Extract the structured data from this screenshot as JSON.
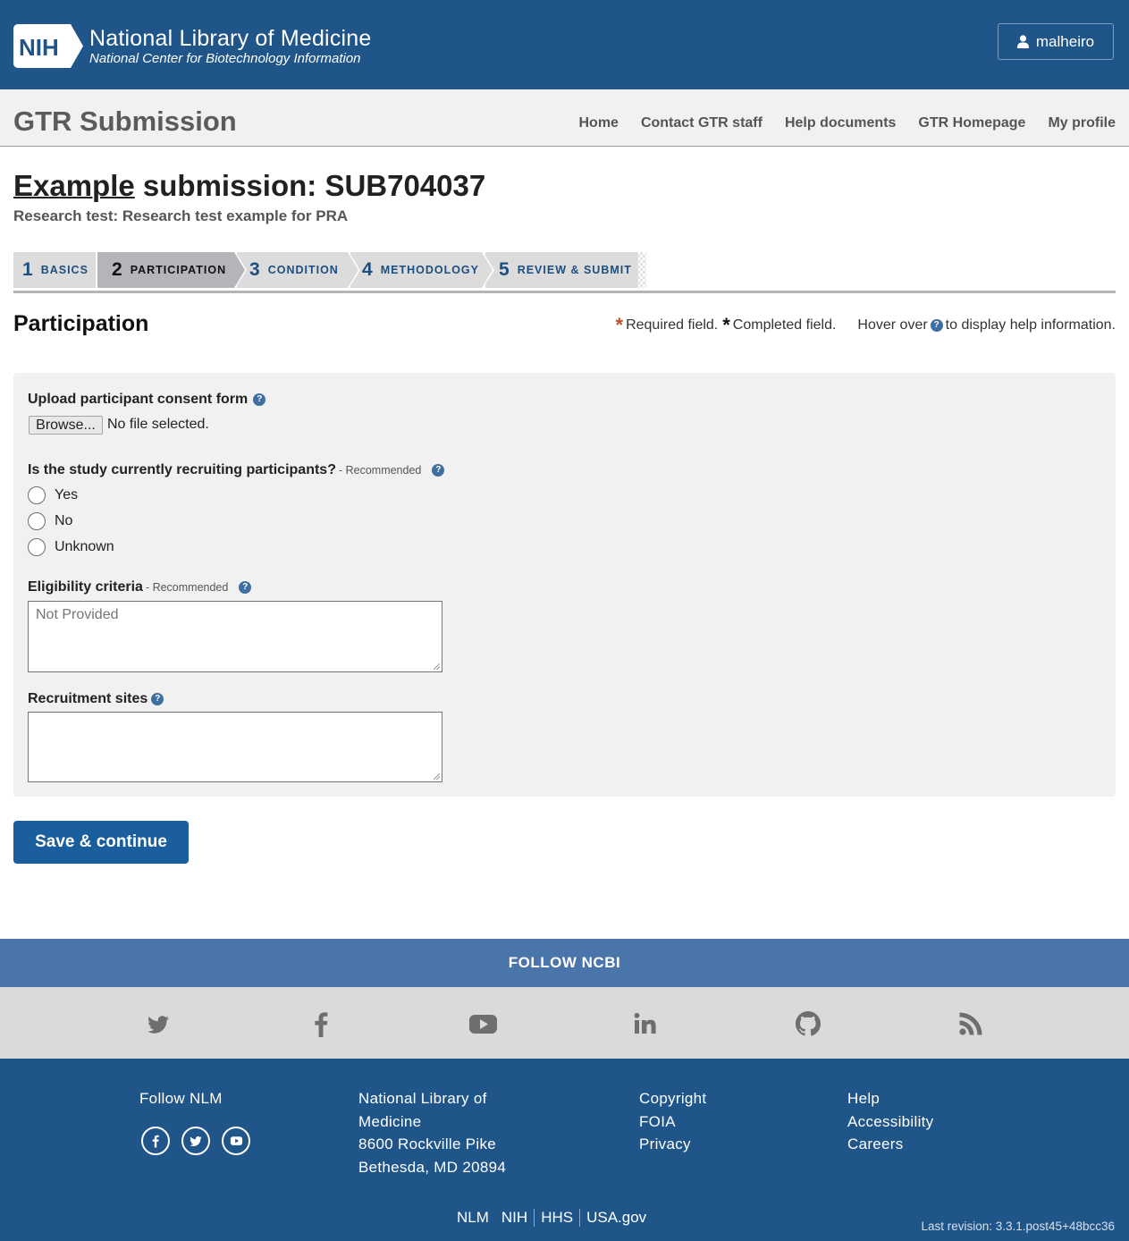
{
  "header": {
    "logo_text": "NIH",
    "title": "National Library of Medicine",
    "subtitle": "National Center for Biotechnology Information",
    "user_name": "malheiro"
  },
  "gtr": {
    "title": "GTR Submission",
    "nav": [
      "Home",
      "Contact GTR staff",
      "Help documents",
      "GTR Homepage",
      "My profile"
    ]
  },
  "submission": {
    "title_link": "Example",
    "title_rest": " submission: SUB704037",
    "test_name": "Research test: Research test example for PRA"
  },
  "steps": [
    {
      "num": "1",
      "label": "BASICS"
    },
    {
      "num": "2",
      "label": "PARTICIPATION"
    },
    {
      "num": "3",
      "label": "CONDITION"
    },
    {
      "num": "4",
      "label": "METHODOLOGY"
    },
    {
      "num": "5",
      "label": "REVIEW & SUBMIT"
    }
  ],
  "active_step": "PARTICIPATION",
  "section": {
    "title": "Participation",
    "legend_required": "Required field.",
    "legend_completed": "Completed field.",
    "legend_hover_before": "Hover over",
    "legend_hover_after": "to display help information."
  },
  "form": {
    "consent_label": "Upload participant consent form",
    "browse_label": "Browse...",
    "file_status": "No file selected.",
    "recruiting_label": "Is the study currently recruiting participants?",
    "recommended": "- Recommended",
    "recruiting_options": [
      "Yes",
      "No",
      "Unknown"
    ],
    "eligibility_label": "Eligibility criteria",
    "eligibility_placeholder": "Not Provided",
    "sites_label": "Recruitment sites",
    "sites_value": ""
  },
  "save_label": "Save & continue",
  "footer": {
    "follow_ncbi": "FOLLOW NCBI",
    "social_icons": [
      "twitter-icon",
      "facebook-icon",
      "youtube-icon",
      "linkedin-icon",
      "github-icon",
      "rss-icon"
    ],
    "follow_nlm": "Follow NLM",
    "address": [
      "National Library of",
      "Medicine",
      "8600 Rockville Pike",
      "Bethesda, MD 20894"
    ],
    "links_col3": [
      "Copyright",
      "FOIA",
      "Privacy"
    ],
    "links_col4": [
      "Help",
      "Accessibility",
      "Careers"
    ],
    "bottom_links": [
      "NLM",
      "NIH",
      "HHS",
      "USA.gov"
    ],
    "revision": "Last revision: 3.3.1.post45+48bcc36"
  },
  "colors": {
    "header_blue": "#20558a",
    "button_blue": "#1a5e9d",
    "follow_bar": "#4a75aa",
    "required_star": "#c0502d"
  }
}
